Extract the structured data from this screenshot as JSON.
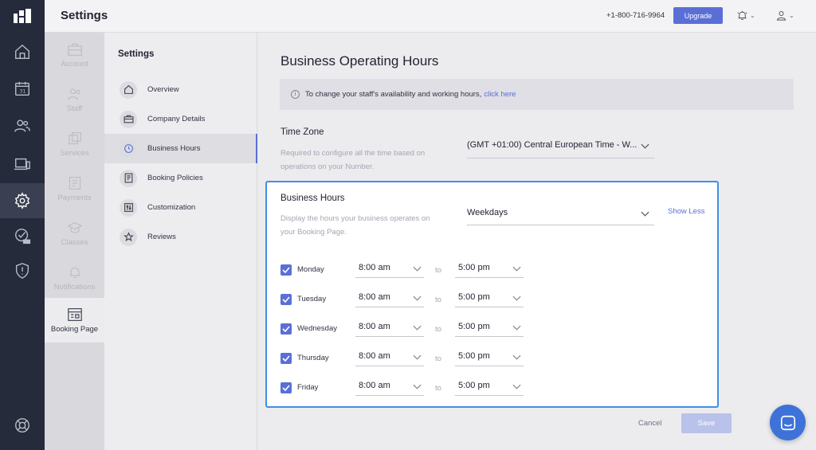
{
  "header": {
    "title": "Settings",
    "phone": "+1-800-716-9964",
    "upgrade_label": "Upgrade",
    "bell_icon": "bell-icon",
    "user_icon": "user-icon"
  },
  "rail": {
    "items": [
      "home-icon",
      "calendar-icon",
      "customers-icon",
      "devices-icon",
      "settings-icon",
      "tasks-beta-icon",
      "shield-icon"
    ],
    "active": "settings-icon",
    "bottom": "help-icon"
  },
  "subnav": {
    "items": [
      {
        "label": "Account"
      },
      {
        "label": "Staff"
      },
      {
        "label": "Services"
      },
      {
        "label": "Payments"
      },
      {
        "label": "Classes"
      },
      {
        "label": "Notifications"
      },
      {
        "label": "Booking Page"
      }
    ],
    "active": "Booking Page"
  },
  "settings_menu": {
    "heading": "Settings",
    "items": [
      {
        "label": "Overview",
        "icon": "home-icon"
      },
      {
        "label": "Company Details",
        "icon": "briefcase-icon"
      },
      {
        "label": "Business Hours",
        "icon": "clock-icon"
      },
      {
        "label": "Booking Policies",
        "icon": "document-icon"
      },
      {
        "label": "Customization",
        "icon": "sliders-icon"
      },
      {
        "label": "Reviews",
        "icon": "star-icon"
      }
    ],
    "active": "Business Hours"
  },
  "main": {
    "title": "Business Operating Hours",
    "info_text": "To change your staff's availability and working hours,",
    "info_link": "click here",
    "timezone": {
      "label": "Time Zone",
      "help": "Required to configure all the time based on operations on your Number.",
      "value": "(GMT +01:00) Central European Time - W..."
    },
    "business_hours": {
      "label": "Business Hours",
      "help": "Display the hours your business operates on your Booking Page.",
      "preset": "Weekdays",
      "show_less": "Show Less",
      "to_label": "to",
      "days": [
        {
          "day": "Monday",
          "checked": true,
          "from": "8:00 am",
          "to": "5:00 pm"
        },
        {
          "day": "Tuesday",
          "checked": true,
          "from": "8:00 am",
          "to": "5:00 pm"
        },
        {
          "day": "Wednesday",
          "checked": true,
          "from": "8:00 am",
          "to": "5:00 pm"
        },
        {
          "day": "Thursday",
          "checked": true,
          "from": "8:00 am",
          "to": "5:00 pm"
        },
        {
          "day": "Friday",
          "checked": true,
          "from": "8:00 am",
          "to": "5:00 pm"
        }
      ]
    },
    "cancel_label": "Cancel",
    "save_label": "Save"
  },
  "colors": {
    "accent": "#5a6fd6",
    "rail": "#252b3b",
    "card_border": "#3f8fe8"
  }
}
